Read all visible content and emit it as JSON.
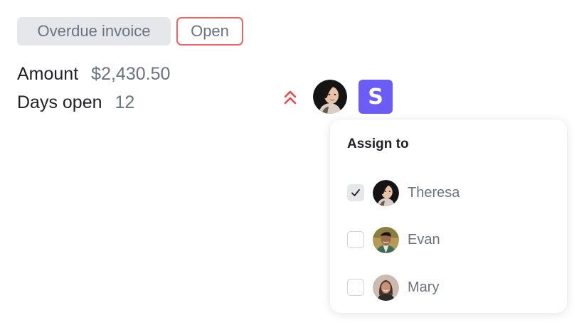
{
  "invoice": {
    "status_tag": "Overdue invoice",
    "state_tag": "Open",
    "amount_label": "Amount",
    "amount_value": "$2,430.50",
    "days_label": "Days open",
    "days_value": "12"
  },
  "header_icons": {
    "priority_icon": "chevrons-up-icon",
    "priority_color": "#ef4444",
    "owner": "Theresa",
    "app_badge_letter": "S",
    "app_badge_color": "#6b5cf6"
  },
  "assign_menu": {
    "title": "Assign to",
    "options": [
      {
        "name": "Theresa",
        "checked": true
      },
      {
        "name": "Evan",
        "checked": false
      },
      {
        "name": "Mary",
        "checked": false
      }
    ]
  }
}
